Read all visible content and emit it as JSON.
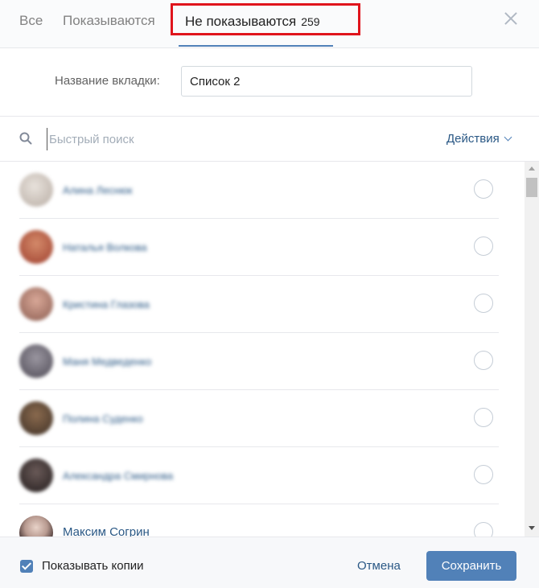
{
  "tabs": {
    "all_label": "Все",
    "shown_label": "Показываются",
    "hidden_label": "Не показываются",
    "hidden_count": "259"
  },
  "tab_name": {
    "label": "Название вкладки:",
    "value": "Список 2"
  },
  "search": {
    "placeholder": "Быстрый поиск",
    "actions_label": "Действия"
  },
  "friends": [
    {
      "name": "Алина Леснюк",
      "blurred": true,
      "avatar_color": "#c9c2bb"
    },
    {
      "name": "Наталья Волкова",
      "blurred": true,
      "avatar_color": "#b5533c"
    },
    {
      "name": "Кристина Глазова",
      "blurred": true,
      "avatar_color": "#a07060"
    },
    {
      "name": "Маня Медведенко",
      "blurred": true,
      "avatar_color": "#6a6570"
    },
    {
      "name": "Полина Суденко",
      "blurred": true,
      "avatar_color": "#5a4a3a"
    },
    {
      "name": "Александра Смирнова",
      "blurred": true,
      "avatar_color": "#3a3030"
    },
    {
      "name": "Максим Согрин",
      "blurred": false,
      "avatar_color": "#8a7a78"
    }
  ],
  "footer": {
    "show_copies_label": "Показывать копии",
    "show_copies_checked": true,
    "cancel_label": "Отмена",
    "save_label": "Сохранить"
  },
  "colors": {
    "accent": "#5181b8",
    "link": "#2a5885",
    "highlight_border": "#e0141c"
  }
}
